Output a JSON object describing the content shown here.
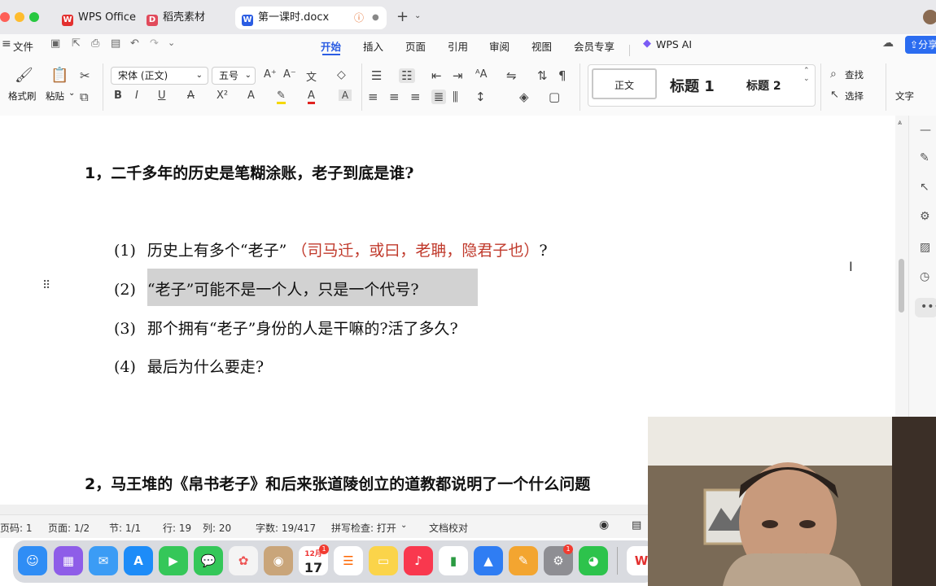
{
  "window": {
    "tabs": [
      {
        "label": "WPS Office",
        "icon": "wps-logo-icon"
      },
      {
        "label": "稻壳素材",
        "icon": "docer-icon"
      },
      {
        "label": "第一课时.docx",
        "icon": "word-doc-icon"
      }
    ],
    "new_tab": "+"
  },
  "menu": {
    "file": "文件",
    "items": [
      "开始",
      "插入",
      "页面",
      "引用",
      "审阅",
      "视图",
      "会员专享"
    ],
    "active": "开始",
    "wps_ai": "WPS AI",
    "share": "分享"
  },
  "ribbon": {
    "format_painter": "格式刷",
    "paste": "粘贴",
    "font_name": "宋体 (正文)",
    "font_size": "五号",
    "styles": {
      "normal": "正文",
      "heading1": "标题 1",
      "heading2": "标题 2"
    },
    "find": "查找",
    "select": "选择",
    "text_tool": "文字"
  },
  "document": {
    "q1": {
      "num": "1",
      "text": "二千多年的历史是笔糊涂账，老子到底是谁?"
    },
    "items": [
      {
        "num": "(1)",
        "before": "历史上有多个“老子”",
        "red": "（司马迁，或曰，老聃，隐君子也）",
        "after": "?"
      },
      {
        "num": "(2)",
        "text": "“老子”可能不是一个人，只是一个代号?"
      },
      {
        "num": "(3)",
        "text": "那个拥有“老子”身份的人是干嘛的?活了多久?"
      },
      {
        "num": "(4)",
        "text": "最后为什么要走?"
      }
    ],
    "q2": {
      "num": "2",
      "text": "马王堆的《帛书老子》和后来张道陵创立的道教都说明了一个什么问题"
    }
  },
  "status_bar": {
    "page_code": "页码: 1",
    "page": "页面: 1/2",
    "section": "节: 1/1",
    "row": "行: 19",
    "col": "列: 20",
    "word_count": "字数: 19/417",
    "spell_check": "拼写检查: 打开",
    "proofread": "文档校对"
  },
  "dock": {
    "calendar_month": "12月",
    "calendar_day": "17",
    "badges": {
      "calendar": "1",
      "settings": "1"
    }
  },
  "colors": {
    "accent": "#2b5de3",
    "red_text": "#c0392b",
    "highlight": "#d2d2d2"
  }
}
